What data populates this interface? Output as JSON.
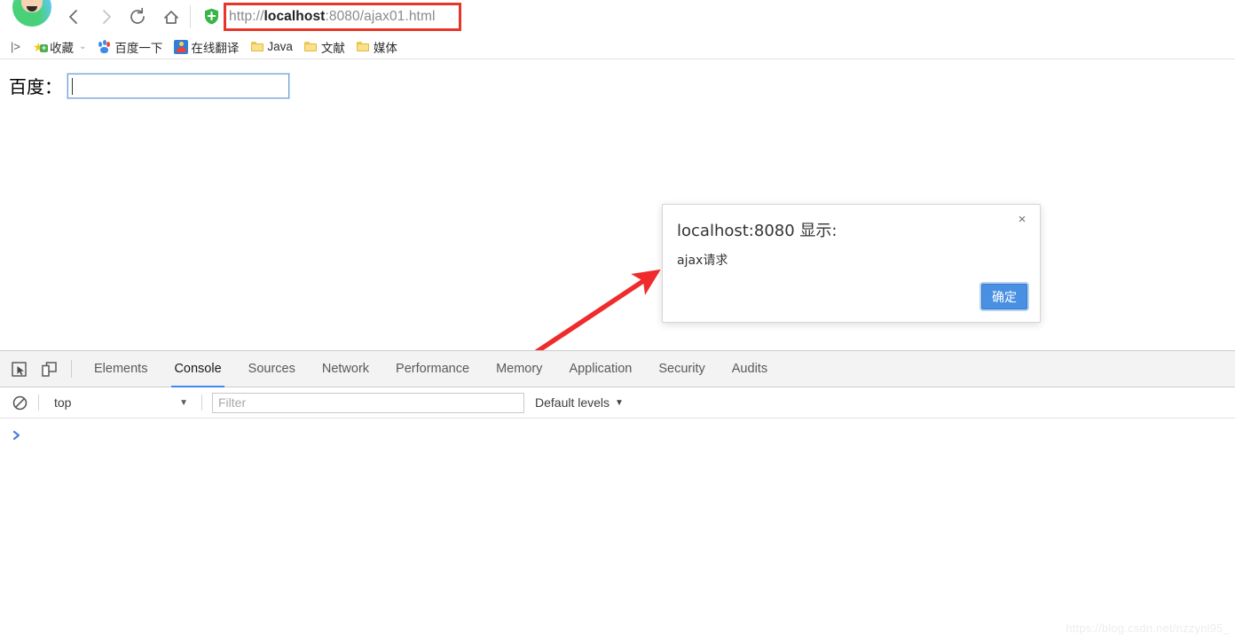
{
  "browser": {
    "nav": {
      "back_label": "Back",
      "forward_label": "Forward",
      "reload_label": "Reload",
      "home_label": "Home"
    },
    "omnibox": {
      "url_scheme": "http://",
      "url_host": "localhost",
      "url_rest": ":8080/ajax01.html",
      "full_url": "http://localhost:8080/ajax01.html",
      "security_icon": "green-shield-icon"
    },
    "annotation_color": "#e8352a"
  },
  "bookmarks": {
    "apps_glyph": "|>",
    "items": [
      {
        "label": "收藏",
        "icon": "star-plus-icon",
        "has_caret": true
      },
      {
        "label": "百度一下",
        "icon": "baidu-paw-icon",
        "has_caret": false
      },
      {
        "label": "在线翻译",
        "icon": "translate-icon",
        "has_caret": false
      },
      {
        "label": "Java",
        "icon": "folder-icon",
        "has_caret": false
      },
      {
        "label": "文献",
        "icon": "folder-icon",
        "has_caret": false
      },
      {
        "label": "媒体",
        "icon": "folder-icon",
        "has_caret": false
      }
    ]
  },
  "page": {
    "baidu_label": "百度：",
    "baidu_input_value": "",
    "baidu_input_placeholder": ""
  },
  "dialog": {
    "title": "localhost:8080 显示:",
    "message": "ajax请求",
    "ok_label": "确定",
    "close_glyph": "×",
    "ok_color": "#4a90e2"
  },
  "devtools": {
    "tool_icons": [
      "inspect-element-icon",
      "device-toolbar-icon"
    ],
    "tabs": [
      {
        "label": "Elements",
        "active": false
      },
      {
        "label": "Console",
        "active": true
      },
      {
        "label": "Sources",
        "active": false
      },
      {
        "label": "Network",
        "active": false
      },
      {
        "label": "Performance",
        "active": false
      },
      {
        "label": "Memory",
        "active": false
      },
      {
        "label": "Application",
        "active": false
      },
      {
        "label": "Security",
        "active": false
      },
      {
        "label": "Audits",
        "active": false
      }
    ],
    "active_tab_underline_color": "#4285f4",
    "filterbar": {
      "clear_icon": "clear-console-icon",
      "context": "top",
      "context_caret": "▼",
      "filter_value": "",
      "filter_placeholder": "Filter",
      "levels": "Default levels",
      "levels_caret": "▼"
    },
    "console": {
      "prompt_glyph": "❯",
      "entries": []
    }
  },
  "watermark": {
    "text": "https://blog.csdn.net/nzzynl95_"
  }
}
